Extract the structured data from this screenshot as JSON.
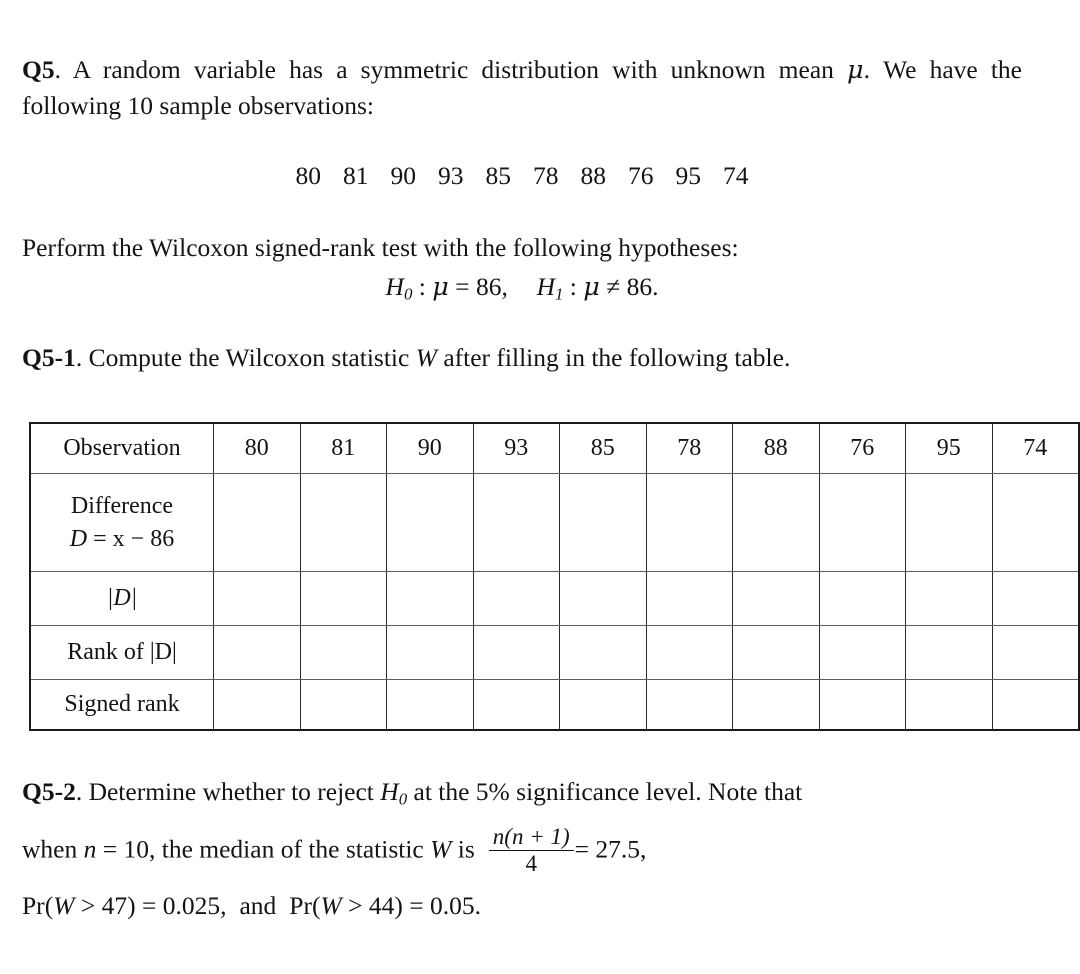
{
  "document": {
    "question_id": "Q5",
    "intro": {
      "label": "Q5",
      "text_part1": ". A random variable has a symmetric distribution with unknown mean ",
      "mean_symbol": "μ",
      "text_part2": ". We have the following 10 sample observations:"
    },
    "sample": {
      "count": 10,
      "values": [
        "80",
        "81",
        "90",
        "93",
        "85",
        "78",
        "88",
        "76",
        "95",
        "74"
      ]
    },
    "hypotheses": {
      "lead_in": "Perform the Wilcoxon signed-rank test with the following hypotheses:",
      "null_symbol": "H",
      "null_subscript": "0",
      "null_relation": " : ",
      "mean_symbol": "μ",
      "null_operator": " = ",
      "null_value": "86,",
      "alt_symbol": "H",
      "alt_subscript": "1",
      "alt_operator": " ≠ ",
      "alt_value": "86."
    },
    "q5_1": {
      "label": "Q5-1",
      "text_part1": ". Compute the Wilcoxon statistic ",
      "statistic": "W",
      "text_part2": " after filling in the following table."
    },
    "table": {
      "rows": [
        {
          "label_plain": "Observation",
          "label_type": "text",
          "cells": [
            "80",
            "81",
            "90",
            "93",
            "85",
            "78",
            "88",
            "76",
            "95",
            "74"
          ]
        },
        {
          "label_plain": "Difference",
          "label_line2_prefix": "D",
          "label_line2_rest": " = x − 86",
          "label_type": "formula",
          "cells": [
            "",
            "",
            "",
            "",
            "",
            "",
            "",
            "",
            "",
            ""
          ]
        },
        {
          "label_plain": "|D|",
          "label_type": "abs",
          "cells": [
            "",
            "",
            "",
            "",
            "",
            "",
            "",
            "",
            "",
            ""
          ]
        },
        {
          "label_plain": "Rank of |D|",
          "label_type": "rank",
          "cells": [
            "",
            "",
            "",
            "",
            "",
            "",
            "",
            "",
            "",
            ""
          ]
        },
        {
          "label_plain": "Signed rank",
          "label_type": "text",
          "cells": [
            "",
            "",
            "",
            "",
            "",
            "",
            "",
            "",
            "",
            ""
          ]
        }
      ]
    },
    "q5_2": {
      "label": "Q5-2",
      "text_part1": ". Determine whether to reject ",
      "null_symbol": "H",
      "null_subscript": "0",
      "text_part2": " at the 5% significance level. Note that",
      "line2_part1": "when ",
      "n_symbol": "n",
      "line2_part2": " = 10, the median of the statistic ",
      "statistic": "W",
      "line2_part3": " is",
      "fraction": {
        "numerator_var": "n",
        "numerator_rest": "(n + 1)",
        "denominator": "4",
        "equals": "= 27.5,",
        "value": "27.5"
      },
      "line3": {
        "pr1_prefix": "Pr",
        "pr1_open": "(",
        "pr1_statistic": "W",
        "pr1_operator": " > ",
        "pr1_threshold": "47",
        "pr1_close": ")",
        "pr1_equals": " = ",
        "pr1_value": "0.025,",
        "conjunction": "and",
        "pr2_prefix": "Pr",
        "pr2_open": "(",
        "pr2_statistic": "W",
        "pr2_operator": " > ",
        "pr2_threshold": "44",
        "pr2_close": ")",
        "pr2_equals": " = ",
        "pr2_value": "0.05."
      }
    }
  }
}
